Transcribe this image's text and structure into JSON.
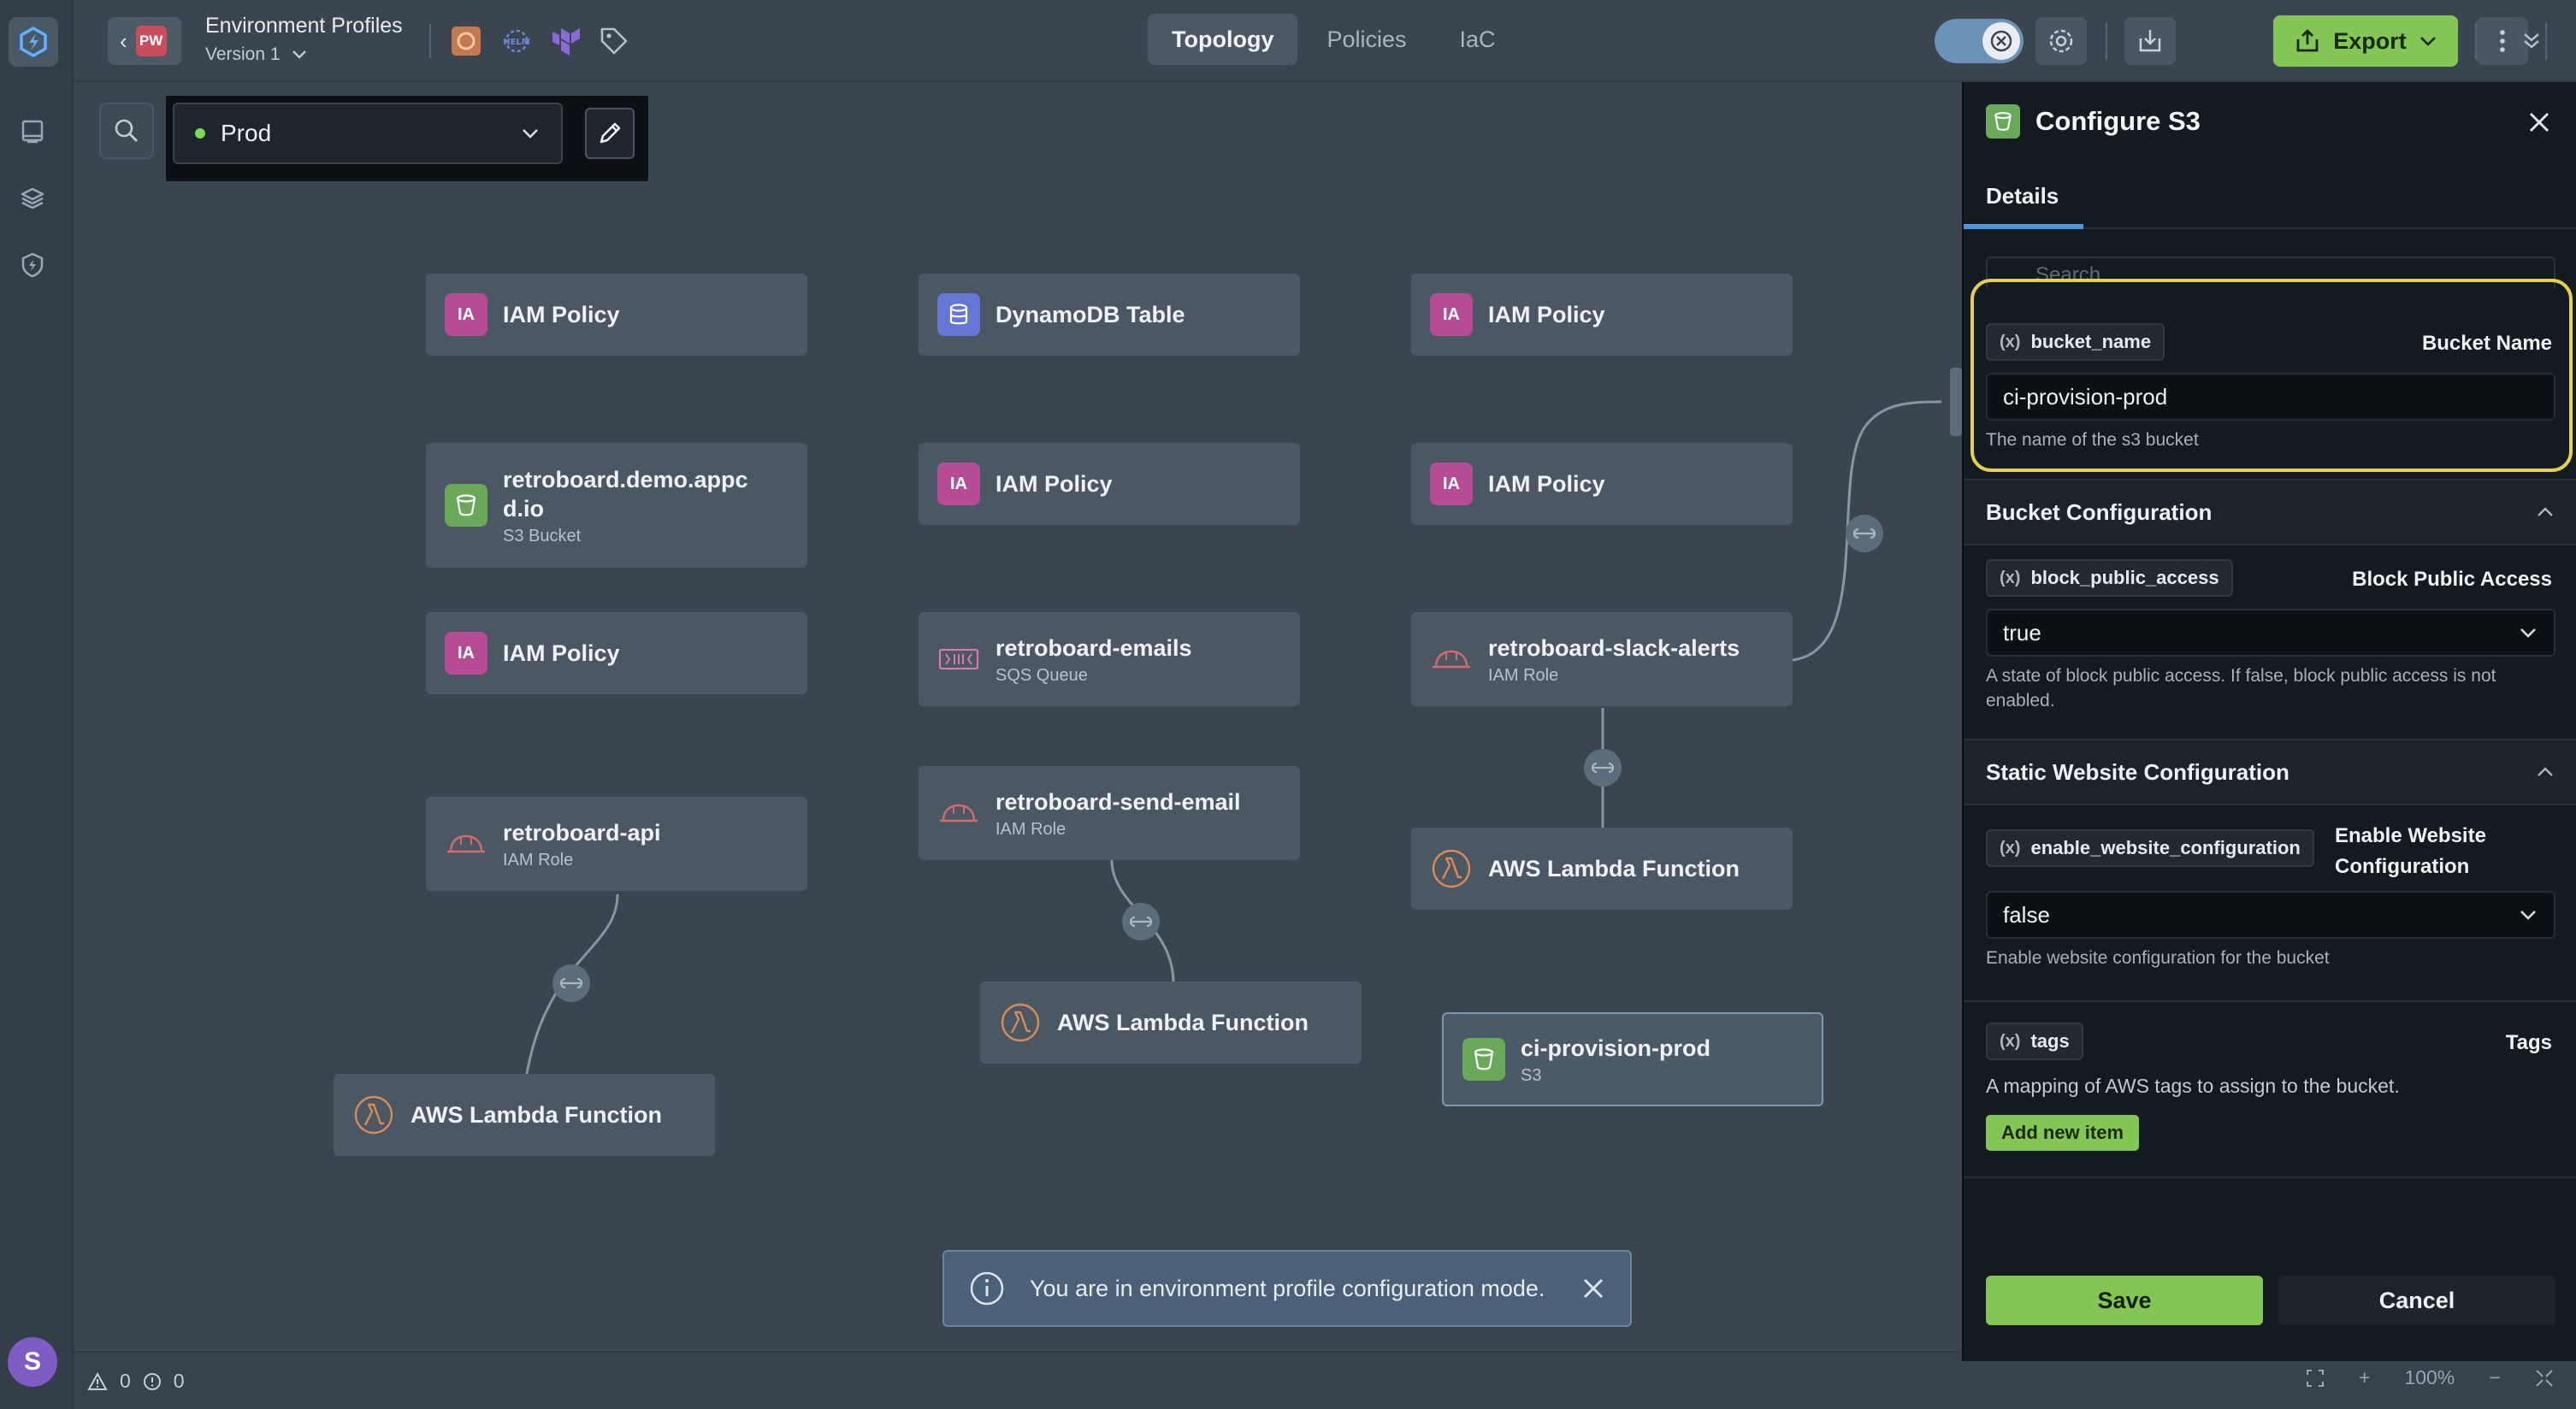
{
  "project": {
    "badge": "PW",
    "title": "Environment Profiles",
    "version": "Version 1"
  },
  "view_tabs": [
    "Topology",
    "Policies",
    "IaC"
  ],
  "active_view": "Topology",
  "export_label": "Export",
  "environment": {
    "selected": "Prod",
    "status_color": "#7ed957"
  },
  "nodes": [
    {
      "id": "n1",
      "title": "IAM Policy",
      "subtitle": "",
      "icon": "IA",
      "kind": "iam"
    },
    {
      "id": "n2",
      "title": "DynamoDB Table",
      "subtitle": "",
      "icon": "",
      "kind": "ddb"
    },
    {
      "id": "n3",
      "title": "IAM Policy",
      "subtitle": "",
      "icon": "IA",
      "kind": "iam"
    },
    {
      "id": "n4",
      "title": "retroboard.demo.appcd.io",
      "subtitle": "S3 Bucket",
      "icon": "",
      "kind": "s3"
    },
    {
      "id": "n5",
      "title": "IAM Policy",
      "subtitle": "",
      "icon": "IA",
      "kind": "iam"
    },
    {
      "id": "n6",
      "title": "IAM Policy",
      "subtitle": "",
      "icon": "IA",
      "kind": "iam"
    },
    {
      "id": "n7",
      "title": "IAM Policy",
      "subtitle": "",
      "icon": "IA",
      "kind": "iam"
    },
    {
      "id": "n8",
      "title": "retroboard-emails",
      "subtitle": "SQS Queue",
      "icon": "",
      "kind": "sqs"
    },
    {
      "id": "n9",
      "title": "retroboard-slack-alerts",
      "subtitle": "IAM Role",
      "icon": "",
      "kind": "role"
    },
    {
      "id": "n10",
      "title": "retroboard-send-email",
      "subtitle": "IAM Role",
      "icon": "",
      "kind": "role"
    },
    {
      "id": "n11",
      "title": "retroboard-api",
      "subtitle": "IAM Role",
      "icon": "",
      "kind": "role"
    },
    {
      "id": "n12",
      "title": "AWS Lambda Function",
      "subtitle": "",
      "icon": "",
      "kind": "lambda"
    },
    {
      "id": "n13",
      "title": "AWS Lambda Function",
      "subtitle": "",
      "icon": "",
      "kind": "lambda"
    },
    {
      "id": "n14",
      "title": "ci-provision-prod",
      "subtitle": "S3",
      "icon": "",
      "kind": "s3"
    },
    {
      "id": "n15",
      "title": "AWS Lambda Function",
      "subtitle": "",
      "icon": "",
      "kind": "lambda"
    }
  ],
  "toast": {
    "message": "You are in environment profile configuration mode."
  },
  "status_bar": {
    "warnings": "0",
    "errors": "0",
    "zoom": "100%"
  },
  "user_initial": "S",
  "panel": {
    "title": "Configure S3",
    "tab": "Details",
    "search_placeholder": "Search",
    "fields": {
      "bucket_name": {
        "var": "bucket_name",
        "label": "Bucket Name",
        "value": "ci-provision-prod",
        "help": "The name of the s3 bucket"
      },
      "block_public_access": {
        "var": "block_public_access",
        "label": "Block Public Access",
        "value": "true",
        "help": "A state of block public access. If false, block public access is not enabled."
      },
      "enable_website_configuration": {
        "var": "enable_website_configuration",
        "label_line1": "Enable Website",
        "label_line2": "Configuration",
        "value": "false",
        "help": "Enable website configuration for the bucket"
      },
      "tags": {
        "var": "tags",
        "label": "Tags",
        "help": "A mapping of AWS tags to assign to the bucket.",
        "add_label": "Add new item"
      }
    },
    "sections": {
      "bucket": "Bucket Configuration",
      "website": "Static Website Configuration"
    },
    "var_marker": "(x)",
    "save_label": "Save",
    "cancel_label": "Cancel"
  },
  "colors": {
    "accent_green": "#84c655",
    "highlight_yellow": "#e8cf4c",
    "iam_pink": "#b54c95",
    "s3_green": "#6aa85a",
    "dynamodb_blue": "#6676d6"
  },
  "icons": [
    "appcd-logo-icon",
    "book-icon",
    "layers-icon",
    "shield-icon",
    "search-icon",
    "pencil-icon",
    "settings-icon",
    "import-icon",
    "upload-icon",
    "kebab-icon",
    "chevron-down-icon",
    "close-icon",
    "info-icon",
    "link-icon",
    "lambda-icon",
    "role-helmet-icon",
    "sqs-icon",
    "bucket-icon",
    "tag-icon"
  ]
}
